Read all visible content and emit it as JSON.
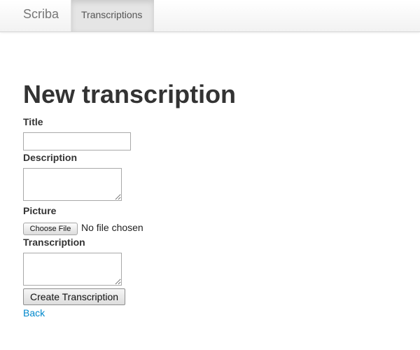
{
  "navbar": {
    "brand": "Scriba",
    "tabs": [
      {
        "label": "Transcriptions",
        "active": true
      }
    ]
  },
  "page": {
    "title": "New transcription"
  },
  "form": {
    "title_label": "Title",
    "title_value": "",
    "description_label": "Description",
    "description_value": "",
    "picture_label": "Picture",
    "file_button_label": "Choose File",
    "file_status": "No file chosen",
    "transcription_label": "Transcription",
    "transcription_value": "",
    "submit_label": "Create Transcription"
  },
  "back_link": "Back",
  "colors": {
    "link": "#0088cc",
    "navbar_background": "#f2f2f2",
    "active_tab_background": "#e5e5e5",
    "heading_text": "#333333"
  }
}
